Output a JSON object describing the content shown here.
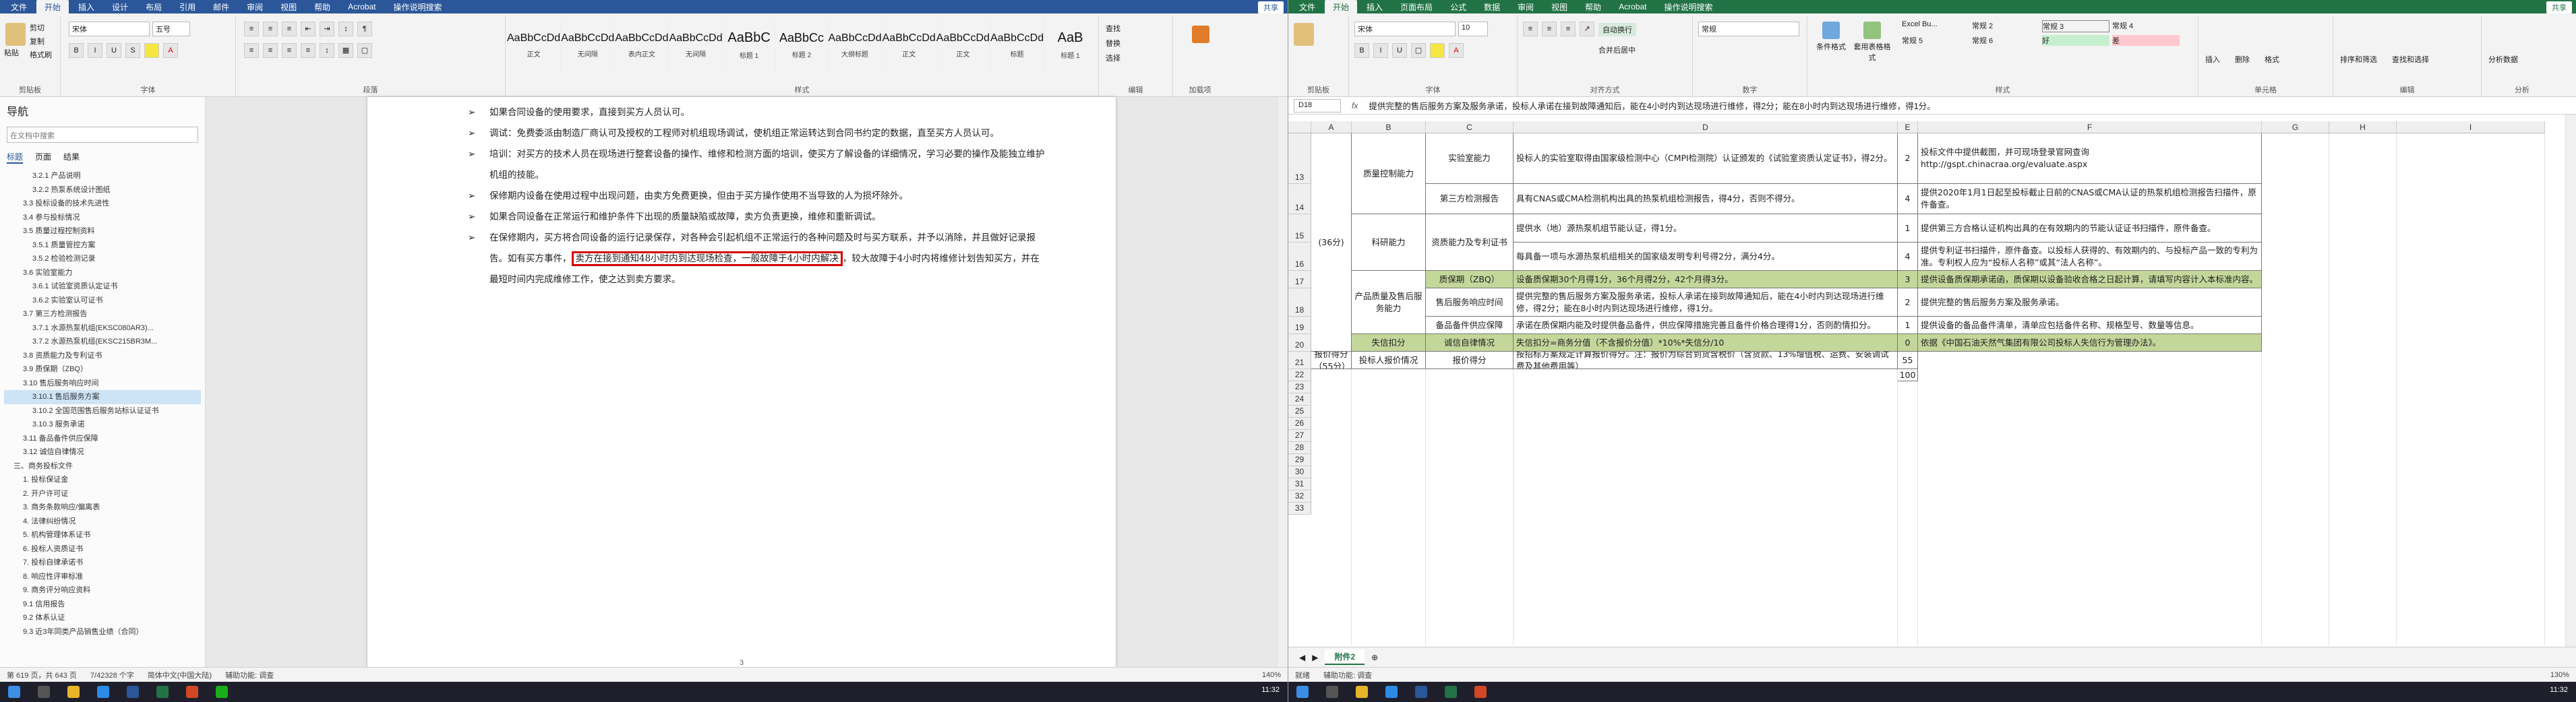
{
  "word": {
    "tabs": [
      "文件",
      "开始",
      "插入",
      "设计",
      "布局",
      "引用",
      "邮件",
      "审阅",
      "视图",
      "帮助",
      "Acrobat",
      "操作说明搜索"
    ],
    "share": "共享",
    "ribbon": {
      "clipboard": {
        "label": "剪贴板",
        "paste": "粘贴",
        "cut": "剪切",
        "copy": "复制",
        "format_painter": "格式刷"
      },
      "font": {
        "label": "字体",
        "font_name": "宋体",
        "font_size": "五号"
      },
      "paragraph": {
        "label": "段落"
      },
      "styles": {
        "label": "样式",
        "items": [
          {
            "sample": "AaBbCcDd",
            "name": "正文"
          },
          {
            "sample": "AaBbCcDd",
            "name": "无间隔"
          },
          {
            "sample": "AaBbCcDd",
            "name": "表内正文"
          },
          {
            "sample": "AaBbCcDd",
            "name": "无间隔"
          },
          {
            "sample": "AaBbC",
            "name": "标题 1"
          },
          {
            "sample": "AaBbCc",
            "name": "标题 2"
          },
          {
            "sample": "AaBbCcDd",
            "name": "大纲标题"
          },
          {
            "sample": "AaBbCcDd",
            "name": "正文"
          },
          {
            "sample": "AaBbCcDd",
            "name": "正文"
          },
          {
            "sample": "AaBbCcDd",
            "name": "标题"
          },
          {
            "sample": "AaB",
            "name": "标题 1"
          }
        ]
      },
      "editing": {
        "label": "编辑",
        "find": "查找",
        "replace": "替换",
        "select": "选择"
      },
      "addins": {
        "label": "加载项"
      }
    },
    "nav": {
      "title": "导航",
      "search_placeholder": "在文档中搜索",
      "tabs": [
        "标题",
        "页面",
        "结果"
      ],
      "items": [
        "3.2.1 产品说明",
        "3.2.2 热泵系统设计图纸",
        "3.3 投标设备的技术先进性",
        "3.4 参与投标情况",
        "3.5 质量过程控制资料",
        "3.5.1 质量管控方案",
        "3.5.2 检验检测记录",
        "3.6 实验室能力",
        "3.6.1 试验室资质认定证书",
        "3.6.2 实验室认可证书",
        "3.7 第三方检测报告",
        "3.7.1 水源热泵机组(EKSC080AR3)...",
        "3.7.2 水源热泵机组(EKSC215BR3M...",
        "3.8 资质能力及专利证书",
        "3.9 质保期（ZBQ）",
        "3.10 售后服务响应时间",
        "3.10.1 售后服务方案",
        "3.10.2 全国范围售后服务站标认证证书",
        "3.10.3 服务承诺",
        "3.11 备品备件供应保障",
        "3.12 诚信自律情况",
        "三、商务投标文件",
        "1. 投标保证金",
        "2. 开户许可证",
        "3. 商务条款响应/偏离表",
        "4. 法律纠纷情况",
        "5. 机构管理体系证书",
        "6. 投标人资质证书",
        "7. 投标自律承诺书",
        "8. 响应性评审标准",
        "9. 商务评分响应资料",
        "9.1 信用报告",
        "9.2 体系认证",
        "9.3 近3年同类产品销售业绩（合同）"
      ]
    },
    "doc": {
      "paragraphs": [
        "如果合同设备的使用要求，直接到买方人员认可。",
        "调试：免费委派由制造厂商认可及授权的工程师对机组现场调试，使机组正常运转达到合同书约定的数据，直至买方人员认可。",
        "培训：对买方的技术人员在现场进行整套设备的操作、维修和检测方面的培训，使买方了解设备的详细情况，学习必要的操作及能独立维护机组的技能。",
        "保修期内设备在使用过程中出现问题，由卖方免费更换，但由于买方操作使用不当导致的人为损坏除外。",
        "如果合同设备在正常运行和维护条件下出现的质量缺陷或故障，卖方负责更换，维修和重新调试。",
        "在保修期内，买方将合同设备的运行记录保存，对各种会引起机组不正常运行的各种问题及时与买方联系，并予以消除，并且做好记录报告。如有买方事件，"
      ],
      "highlight": "卖方在接到通知48小时内到达现场检查，一般故障于4小时内解决",
      "after_highlight": "，较大故障于4小时内将维修计划告知买方，并在最短时间内完成维修工作，使之达到卖方要求。",
      "page_num": "3"
    },
    "status": {
      "page": "第 619 页，共 643 页",
      "words": "7/42328 个字",
      "lang": "简体中文(中国大陆)",
      "focus": "辅助功能: 调查",
      "zoom": "140%"
    }
  },
  "excel": {
    "tabs": [
      "文件",
      "开始",
      "插入",
      "页面布局",
      "公式",
      "数据",
      "审阅",
      "视图",
      "帮助",
      "Acrobat",
      "操作说明搜索"
    ],
    "share": "共享",
    "ribbon": {
      "font_name": "宋体",
      "font_size": "10",
      "wrap": "自动换行",
      "merge": "合并后居中",
      "number_format": "常规",
      "groups": [
        "剪贴板",
        "字体",
        "对齐方式",
        "数字",
        "样式",
        "单元格",
        "编辑",
        "分析"
      ],
      "cond_format": "条件格式",
      "format_table": "套用表格格式",
      "styles": [
        "Excel Bu...",
        "常规 2",
        "常规 3",
        "常规 4",
        "常规 5",
        "常规 6",
        "好",
        "差",
        "常规",
        "适中"
      ],
      "insert": "插入",
      "delete": "删除",
      "format": "格式",
      "sort": "排序和筛选",
      "find": "查找和选择",
      "analyze": "分析数据"
    },
    "name_box": "D18",
    "formula": "提供完整的售后服务方案及服务承诺，投标人承诺在接到故障通知后，能在4小时内到达现场进行维修，得2分；能在8小时内到达现场进行维修，得1分。",
    "cols": [
      "A",
      "B",
      "C",
      "D",
      "E",
      "F",
      "G",
      "H",
      "I"
    ],
    "rows": [
      {
        "num": "13",
        "A": "(36分)",
        "B": "质量控制能力",
        "C": "实验室能力",
        "D": "投标人的实验室取得由国家级检测中心（CMPI检测院）认证颁发的《试验室资质认定证书》，得2分。",
        "E": "2",
        "F": "投标文件中提供截图，并可现场登录官网查询 http://gspt.chinacraa.org/evaluate.aspx"
      },
      {
        "num": "14",
        "C": "第三方检测报告",
        "D": "具有CNAS或CMA检测机构出具的热泵机组检测报告，得4分，否则不得分。",
        "E": "4",
        "F": "提供2020年1月1日起至投标截止日前的CNAS或CMA认证的热泵机组检测报告扫描件，原件备查。"
      },
      {
        "num": "15",
        "B": "科研能力",
        "C": "资质能力及专利证书",
        "D": "提供水（地）源热泵机组节能认证，得1分。",
        "E": "1",
        "F": "提供第三方合格认证机构出具的在有效期内的节能认证证书扫描件，原件备查。"
      },
      {
        "num": "16",
        "D": "每具备一项与水源热泵机组相关的国家级发明专利号得2分，满分4分。",
        "E": "4",
        "F": "提供专利证书扫描件，原件备查。以投标人获得的、有效期内的、与投标产品一致的专利为准。专利权人应为“投标人名称”或其“法人名称”。"
      },
      {
        "num": "17",
        "B": "产品质量及售后服务能力",
        "C": "质保期（ZBQ）",
        "D": "设备质保期30个月得1分，36个月得2分，42个月得3分。",
        "E": "3",
        "F": "提供设备质保期承诺函，质保期以设备验收合格之日起计算，请填写内容计入本标准内容。",
        "green": true
      },
      {
        "num": "18",
        "C": "售后服务响应时间",
        "D": "提供完整的售后服务方案及服务承诺，投标人承诺在接到故障通知后，能在4小时内到达现场进行维修，得2分；能在8小时内到达现场进行维修，得1分。",
        "E": "2",
        "F": "提供完整的售后服务方案及服务承诺。"
      },
      {
        "num": "19",
        "C": "备品备件供应保障",
        "D": "承诺在质保期内能及时提供备品备件，供应保障措施完善且备件价格合理得1分，否则酌情扣分。",
        "E": "1",
        "F": "提供设备的备品备件清单，清单应包括备件名称、规格型号、数量等信息。"
      },
      {
        "num": "20",
        "B": "失信扣分",
        "C": "诚信自律情况",
        "D": "失信扣分=商务分值（不含报价分值）*10%*失信分/10",
        "E": "0",
        "F": "依据《中国石油天然气集团有限公司投标人失信行为管理办法》。",
        "green": true
      },
      {
        "num": "21",
        "A": "报价得分（55分）",
        "B": "投标人报价情况",
        "C": "报价得分",
        "D": "按招标方案规定计算报价得分。注：报价为综合到货含税价（含货款、13%增值税、运费、安装调试费及其他费用等）",
        "E": "55"
      },
      {
        "num": "22",
        "E": "100"
      }
    ],
    "empty_rows": [
      "23",
      "24",
      "25",
      "26",
      "27",
      "28",
      "29",
      "30",
      "31",
      "32",
      "33"
    ],
    "sheet_tab": "附件2",
    "status": {
      "ready": "就绪",
      "focus": "辅助功能: 调查",
      "zoom": "130%"
    }
  },
  "taskbar": {
    "time_left": "11:32",
    "time_right": "11:32"
  },
  "colors": {
    "word_blue": "#2b579a",
    "excel_green": "#217346",
    "highlight_red": "#d50000",
    "cell_green": "#c4d79b"
  }
}
